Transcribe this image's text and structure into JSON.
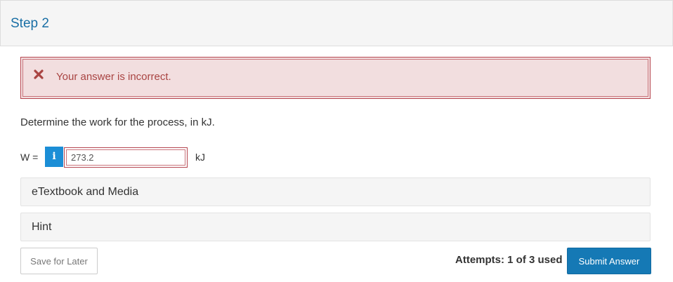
{
  "step": {
    "title": "Step 2"
  },
  "feedback": {
    "icon": "close-icon",
    "message": "Your answer is incorrect.",
    "color": "#a94442",
    "background": "#f2dedf"
  },
  "question": {
    "prompt": "Determine the work for the process, in kJ.",
    "variable_label": "W =",
    "info_icon": "info-icon",
    "answer_value": "273.2",
    "unit": "kJ"
  },
  "resources": {
    "etextbook_label": "eTextbook and Media",
    "hint_label": "Hint"
  },
  "footer": {
    "save_label": "Save for Later",
    "attempts_text": "Attempts: 1 of 3 used",
    "submit_label": "Submit Answer",
    "submit_color": "#1579b5"
  }
}
